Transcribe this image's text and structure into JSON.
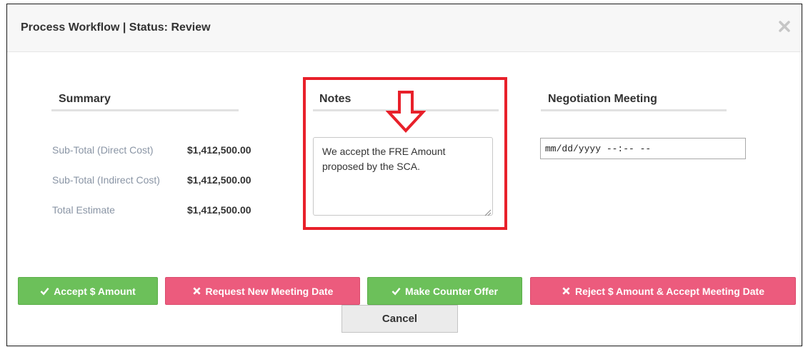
{
  "dialog": {
    "title": "Process Workflow | Status: Review",
    "close_icon": "close-icon"
  },
  "summary": {
    "heading": "Summary",
    "rows": [
      {
        "label": "Sub-Total (Direct Cost)",
        "value": "$1,412,500.00"
      },
      {
        "label": "Sub-Total (Indirect Cost)",
        "value": "$1,412,500.00"
      },
      {
        "label": "Total Estimate",
        "value": "$1,412,500.00"
      }
    ]
  },
  "notes": {
    "heading": "Notes",
    "value": "We accept the FRE Amount proposed by the SCA.",
    "highlight_color": "#e8202a",
    "arrow_icon": "down-arrow-icon"
  },
  "meeting": {
    "heading": "Negotiation Meeting",
    "placeholder": "mm/dd/yyyy --:-- --"
  },
  "buttons": {
    "accept": {
      "label": "Accept $ Amount",
      "icon": "check-icon"
    },
    "request": {
      "label": "Request New Meeting Date",
      "icon": "times-icon"
    },
    "counter": {
      "label": "Make Counter Offer",
      "icon": "check-icon"
    },
    "reject": {
      "label": "Reject $ Amount & Accept Meeting Date",
      "icon": "times-icon"
    },
    "cancel": {
      "label": "Cancel"
    }
  },
  "colors": {
    "success": "#6cc05a",
    "danger": "#ec5b7d",
    "annotation": "#e8202a"
  }
}
